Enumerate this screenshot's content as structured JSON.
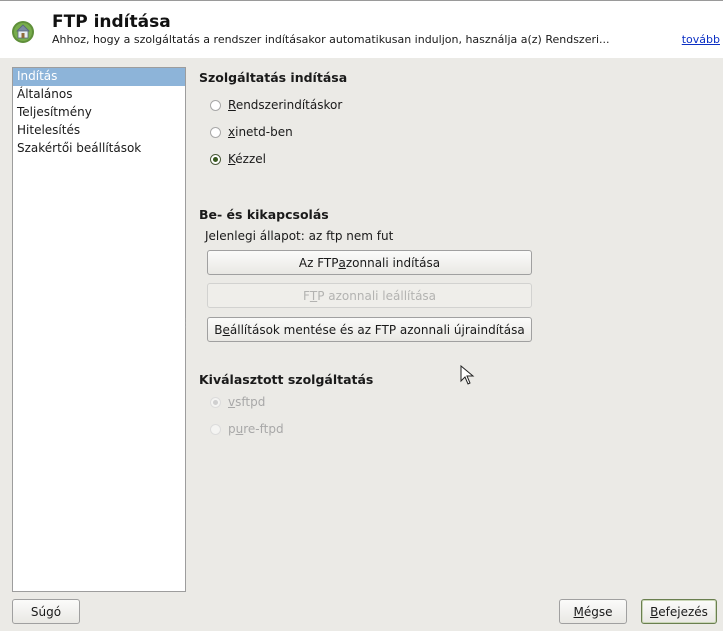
{
  "header": {
    "title": "FTP indítása",
    "description": "Ahhoz, hogy a szolgáltatás a rendszer indításakor automatikusan induljon, használja a(z) Rendszeri...",
    "more_link": "tovább"
  },
  "sidebar": {
    "items": [
      {
        "label": "Indítás",
        "selected": true
      },
      {
        "label": "Általános",
        "selected": false
      },
      {
        "label": "Teljesítmény",
        "selected": false
      },
      {
        "label": "Hitelesítés",
        "selected": false
      },
      {
        "label": "Szakértői beállítások",
        "selected": false
      }
    ]
  },
  "service_start": {
    "title": "Szolgáltatás indítása",
    "options": [
      {
        "label": "Rendszerindításkor",
        "mnemonic": "R",
        "rest": "endszerindításkor",
        "checked": false
      },
      {
        "label": "xinetd-ben",
        "mnemonic": "x",
        "rest": "inetd-ben",
        "checked": false
      },
      {
        "label": "Kézzel",
        "mnemonic": "K",
        "rest": "ézzel",
        "checked": true
      }
    ]
  },
  "onoff": {
    "title": "Be- és kikapcsolás",
    "status_label": "Jelenlegi állapot:",
    "status_value": "az ftp nem fut",
    "start_button": {
      "before": "Az FTP ",
      "mnemonic": "a",
      "after": "zonnali indítása"
    },
    "stop_button": {
      "before": "F",
      "mnemonic": "T",
      "after": "P azonnali leállítása"
    },
    "save_restart_button": {
      "before": "B",
      "mnemonic": "e",
      "after": "állítások mentése és az FTP azonnali újraindítása"
    }
  },
  "selected_service": {
    "title": "Kiválasztott szolgáltatás",
    "options": [
      {
        "label": "vsftpd",
        "mnemonic": "v",
        "rest": "sftpd",
        "checked": true
      },
      {
        "label": "pure-ftpd",
        "mnemonic": "u",
        "before": "p",
        "rest": "re-ftpd",
        "checked": false
      }
    ]
  },
  "footer": {
    "help_button": "Súgó",
    "cancel_button": {
      "mnemonic": "M",
      "rest": "égse"
    },
    "finish_button": {
      "mnemonic": "B",
      "rest": "efejezés"
    }
  },
  "colors": {
    "selection": "#8db4d9",
    "link": "#0b2fc4",
    "background": "#ebeae6"
  }
}
